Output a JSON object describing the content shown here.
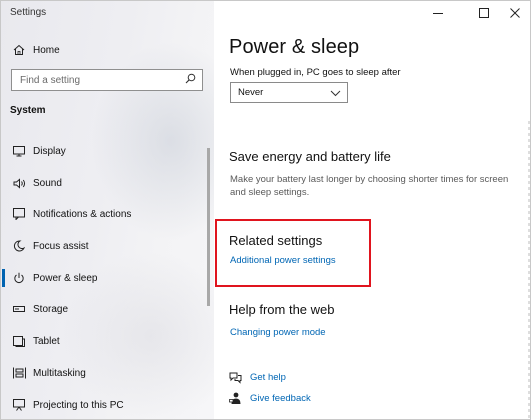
{
  "window": {
    "title": "Settings",
    "controls": {
      "minimize": "—",
      "maximize": "☐",
      "close": "✕"
    }
  },
  "sidebar": {
    "home_label": "Home",
    "search_placeholder": "Find a setting",
    "section_heading": "System",
    "items": [
      {
        "label": "Display",
        "icon": "display-icon"
      },
      {
        "label": "Sound",
        "icon": "speaker-icon"
      },
      {
        "label": "Notifications & actions",
        "icon": "notification-icon"
      },
      {
        "label": "Focus assist",
        "icon": "moon-icon"
      },
      {
        "label": "Power & sleep",
        "icon": "power-icon",
        "active": true
      },
      {
        "label": "Storage",
        "icon": "storage-icon"
      },
      {
        "label": "Tablet",
        "icon": "tablet-icon"
      },
      {
        "label": "Multitasking",
        "icon": "multitasking-icon"
      },
      {
        "label": "Projecting to this PC",
        "icon": "projector-icon"
      }
    ]
  },
  "main": {
    "title": "Power & sleep",
    "sleep_label": "When plugged in, PC goes to sleep after",
    "sleep_value": "Never",
    "save_energy": {
      "title": "Save energy and battery life",
      "description": "Make your battery last longer by choosing shorter times for screen and sleep settings."
    },
    "related": {
      "title": "Related settings",
      "link": "Additional power settings"
    },
    "help": {
      "title": "Help from the web",
      "link": "Changing power mode"
    },
    "get_help": "Get help",
    "give_feedback": "Give feedback"
  },
  "colors": {
    "accent": "#0063b1",
    "link": "#0066b4",
    "highlight_box": "#e0141e"
  }
}
